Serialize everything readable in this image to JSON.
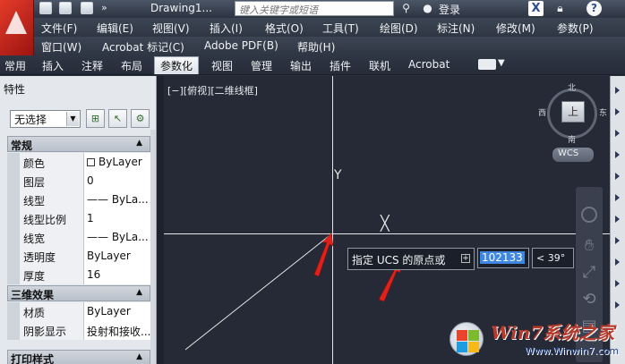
{
  "titlebar": {
    "doc_title": "Drawing1...",
    "search_placeholder": "键入关键字或短语",
    "login_label": "登录",
    "quick_access_more": "»"
  },
  "menu": {
    "row1": [
      "文件(F)",
      "编辑(E)",
      "视图(V)",
      "插入(I)",
      "格式(O)",
      "工具(T)",
      "绘图(D)",
      "标注(N)",
      "修改(M)",
      "参数(P)"
    ],
    "row2": [
      "窗口(W)",
      "Acrobat 标记(C)",
      "Adobe PDF(B)",
      "帮助(H)"
    ]
  },
  "ribbon": {
    "tabs": [
      "常用",
      "插入",
      "注释",
      "布局",
      "参数化",
      "视图",
      "管理",
      "输出",
      "插件",
      "联机",
      "Acrobat"
    ],
    "active_tab": "参数化"
  },
  "palette": {
    "title": "特性",
    "selection": "无选择",
    "sections": {
      "general": "常规",
      "3d": "三维效果",
      "print": "打印样式"
    },
    "general_rows": [
      {
        "key": "颜色",
        "value": "ByLayer"
      },
      {
        "key": "图层",
        "value": "0"
      },
      {
        "key": "线型",
        "value": "—— ByLa..."
      },
      {
        "key": "线型比例",
        "value": "1"
      },
      {
        "key": "线宽",
        "value": "—— ByLa..."
      },
      {
        "key": "透明度",
        "value": "ByLayer"
      },
      {
        "key": "厚度",
        "value": "16"
      }
    ],
    "threed_rows": [
      {
        "key": "材质",
        "value": "ByLayer"
      },
      {
        "key": "阴影显示",
        "value": "投射和接收..."
      }
    ]
  },
  "viewport": {
    "label": "[−][俯视][二维线框]",
    "ucs_y": "Y",
    "ucs_x": "╳"
  },
  "command": {
    "prompt": "指定 UCS 的原点或",
    "input_value": "102133",
    "angle": "< 39°"
  },
  "viewcube": {
    "north": "北",
    "south": "南",
    "west": "西",
    "east": "东",
    "face": "上",
    "wcs": "WCS"
  },
  "watermark": {
    "brand": "Win7系统之家",
    "url": "Www.Winwin7.com"
  },
  "colors": {
    "canvas_bg": "#252a36",
    "arrow_red": "#e0201a",
    "input_highlight": "#3e86e0"
  }
}
